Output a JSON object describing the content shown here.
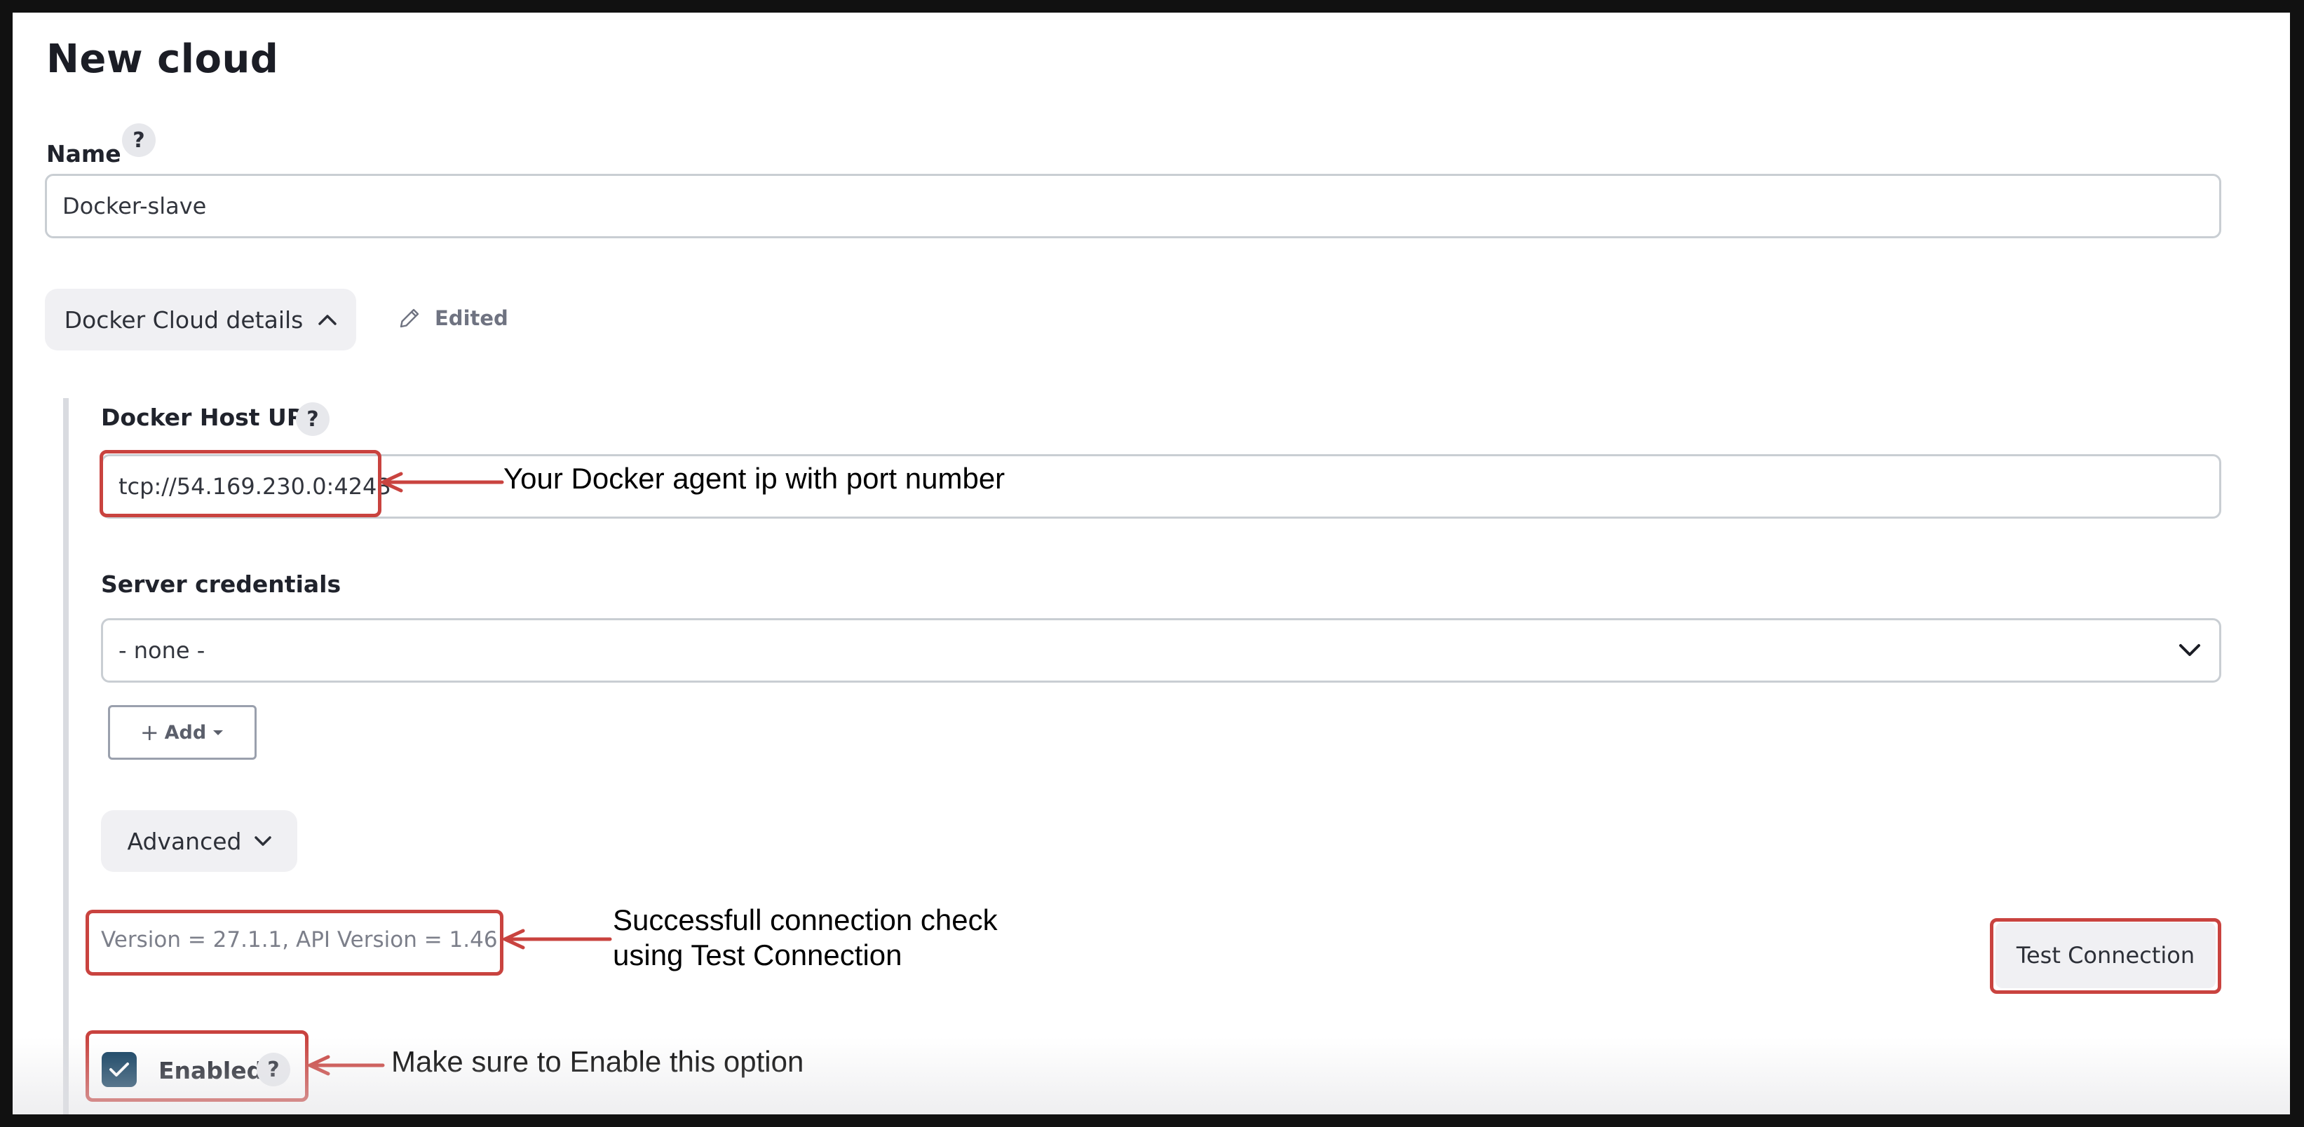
{
  "page": {
    "title": "New cloud"
  },
  "name_field": {
    "label": "Name",
    "help": "?",
    "value": "Docker-slave"
  },
  "section": {
    "label": "Docker Cloud details",
    "edited_label": "Edited"
  },
  "docker_host": {
    "label": "Docker Host URI",
    "help": "?",
    "value": "tcp://54.169.230.0:4243"
  },
  "credentials": {
    "label": "Server credentials",
    "selected": "- none -",
    "add_label": "Add"
  },
  "advanced": {
    "label": "Advanced"
  },
  "connection": {
    "version_text": "Version = 27.1.1, API Version = 1.46",
    "test_button": "Test Connection"
  },
  "enabled": {
    "label": "Enabled",
    "help": "?",
    "checked": true
  },
  "annotations": {
    "host_note": "Your Docker agent ip with port number",
    "connection_note_line1": "Successfull connection check",
    "connection_note_line2": "using Test Connection",
    "enabled_note": "Make sure to Enable this option",
    "color": "#c9433f"
  },
  "colors": {
    "checkbox": "#0f3d5e",
    "annotation": "#c9433f"
  }
}
